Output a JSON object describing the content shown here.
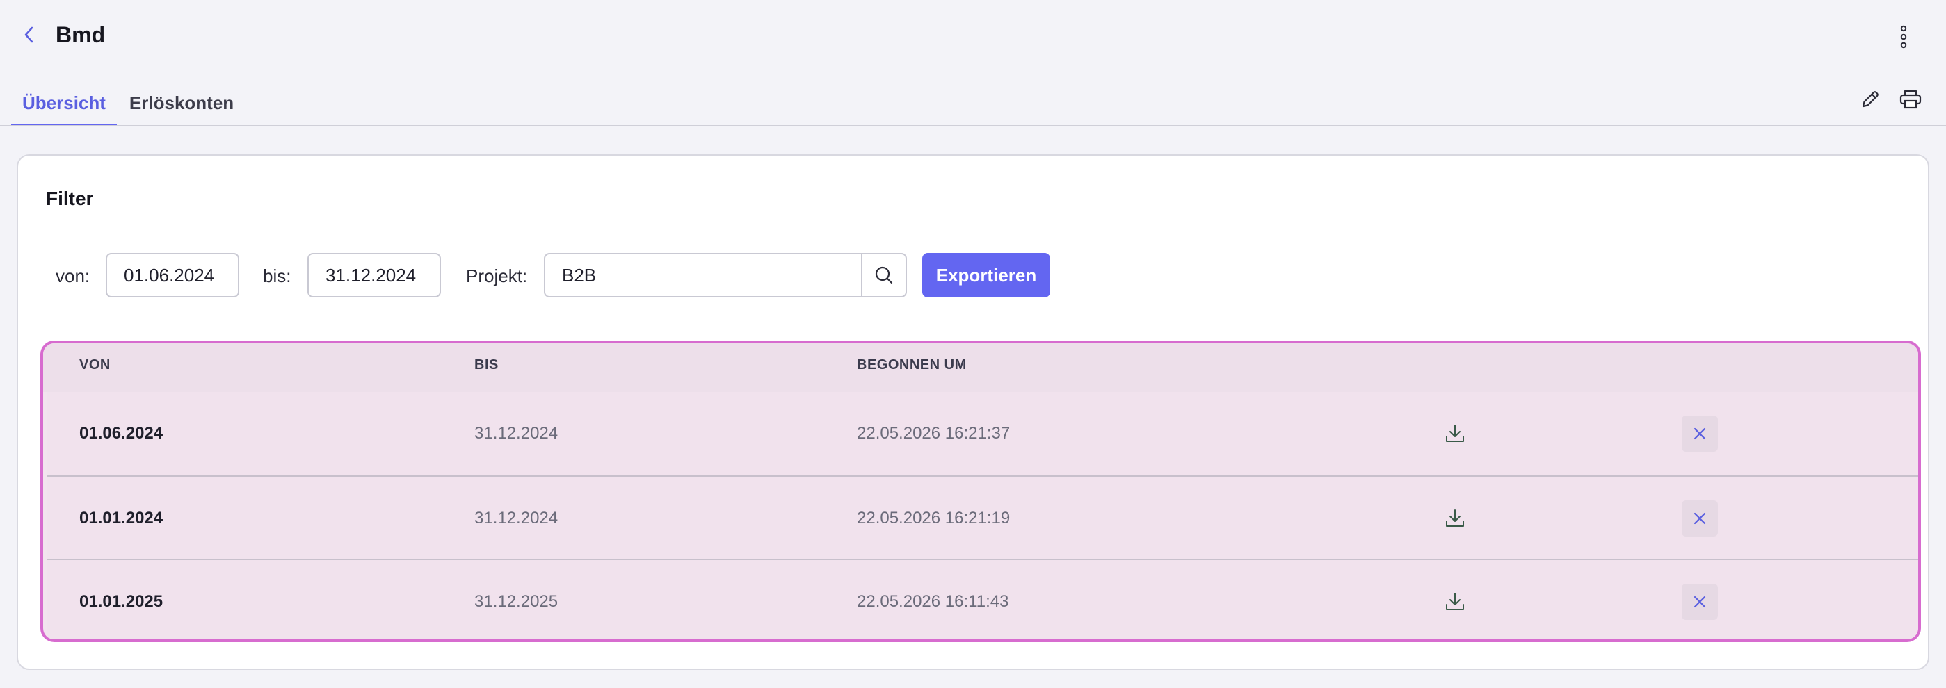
{
  "header": {
    "title": "Bmd",
    "back_icon": "chevron-left-icon",
    "more_icon": "more-vertical-icon"
  },
  "tabs": [
    {
      "label": "Übersicht",
      "active": true
    },
    {
      "label": "Erlöskonten",
      "active": false
    }
  ],
  "toolbar": {
    "edit_icon": "pencil-icon",
    "print_icon": "printer-icon"
  },
  "filter": {
    "title": "Filter",
    "from_label": "von:",
    "from_value": "01.06.2024",
    "to_label": "bis:",
    "to_value": "31.12.2024",
    "project_label": "Projekt:",
    "project_value": "B2B",
    "export_label": "Exportieren"
  },
  "table": {
    "columns": [
      "VON",
      "BIS",
      "BEGONNEN UM"
    ],
    "rows": [
      {
        "von": "01.06.2024",
        "bis": "31.12.2024",
        "begonnen": "22.05.2026 16:21:37"
      },
      {
        "von": "01.01.2024",
        "bis": "31.12.2024",
        "begonnen": "22.05.2026 16:21:19"
      },
      {
        "von": "01.01.2025",
        "bis": "31.12.2025",
        "begonnen": "22.05.2026 16:11:43"
      }
    ]
  },
  "colors": {
    "accent": "#6366f1",
    "highlight_border": "#d76ccf",
    "row_background": "#f1e2ed"
  }
}
